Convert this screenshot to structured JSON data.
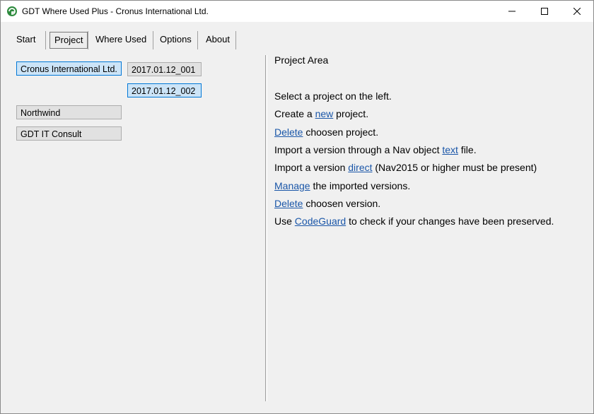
{
  "window": {
    "title": "GDT Where Used Plus - Cronus International Ltd.",
    "icon": "gdt-app-icon"
  },
  "tabs": [
    {
      "label": "Start",
      "active": false
    },
    {
      "label": "Project",
      "active": true
    },
    {
      "label": "Where Used",
      "active": false
    },
    {
      "label": "Options",
      "active": false
    },
    {
      "label": "About",
      "active": false
    }
  ],
  "projects": [
    {
      "name": "Cronus International Ltd.",
      "selected": true
    },
    {
      "name": "Northwind",
      "selected": false
    },
    {
      "name": "GDT IT Consult",
      "selected": false
    }
  ],
  "versions": [
    {
      "name": "2017.01.12_001",
      "selected": false
    },
    {
      "name": "2017.01.12_002",
      "selected": true
    }
  ],
  "project_area": {
    "title": "Project Area",
    "lines": [
      {
        "before": "Select a project on the left.",
        "link": "",
        "after": ""
      },
      {
        "before": "Create a ",
        "link": "new",
        "after": " project."
      },
      {
        "before": "",
        "link": "Delete",
        "after": " choosen project."
      },
      {
        "before": "Import a version through a Nav object ",
        "link": "text",
        "after": " file."
      },
      {
        "before": "Import a version ",
        "link": "direct",
        "after": " (Nav2015 or higher must be present)"
      },
      {
        "before": "",
        "link": "Manage",
        "after": " the imported versions."
      },
      {
        "before": "",
        "link": "Delete",
        "after": " choosen version."
      },
      {
        "before": "Use ",
        "link": "CodeGuard",
        "after": " to check if your changes have been preserved."
      }
    ]
  },
  "colors": {
    "selected_bg": "#cce4f7",
    "selected_border": "#0078d7",
    "link": "#1a56a8"
  }
}
